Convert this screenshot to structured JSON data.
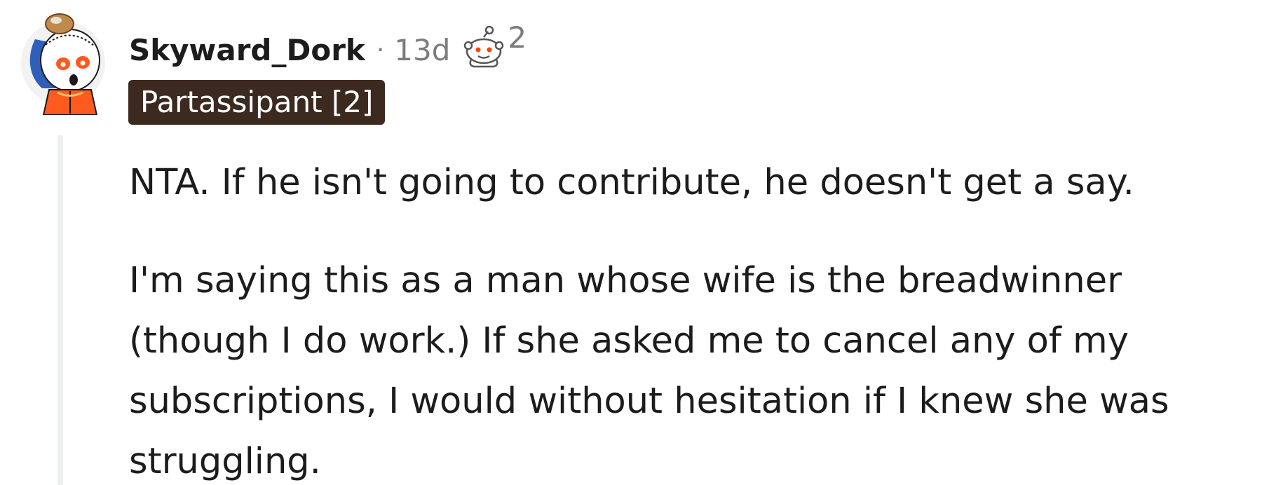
{
  "comment": {
    "username": "Skyward_Dork",
    "separator": "·",
    "age": "13d",
    "award_icon": "snoo-award-icon",
    "award_count": "2",
    "flair": "Partassipant [2]",
    "paragraphs": [
      "NTA. If he isn't going to contribute, he doesn't get a say.",
      "I'm saying this as a man whose wife is the breadwinner (though I do work.) If she asked me to cancel any of my subscriptions, I would without hesitation if I knew she was struggling."
    ]
  },
  "colors": {
    "text": "#1c1c1c",
    "meta": "#7c7c7c",
    "flair_background": "#3c2a20",
    "flair_text": "#ffffff",
    "thread_line": "#edeff1"
  }
}
